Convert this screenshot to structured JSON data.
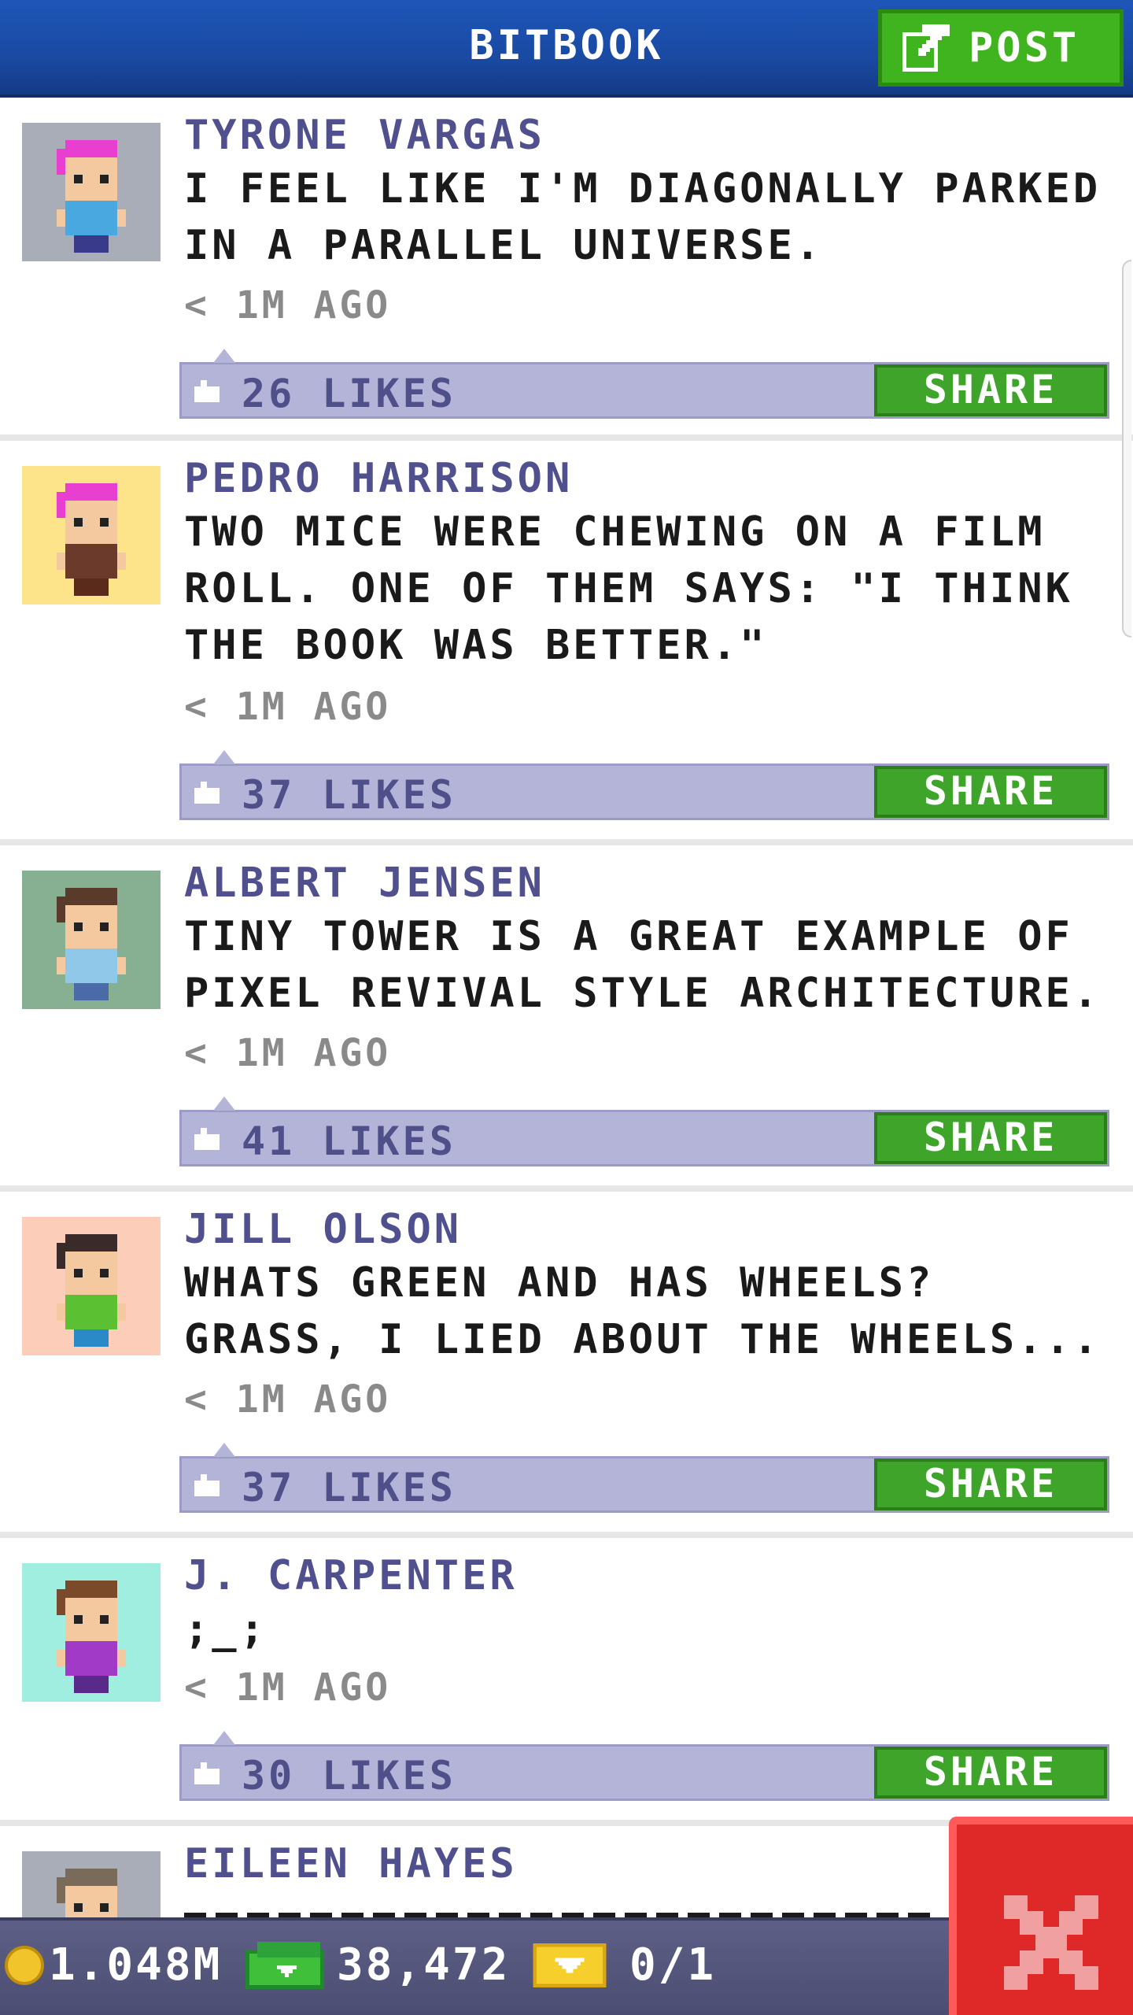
{
  "header": {
    "title": "BITBOOK",
    "post_label": "POST"
  },
  "posts": [
    {
      "author": "TYRONE VARGAS",
      "message": "I FEEL LIKE I'M DIAGONALLY PARKED IN A PARALLEL UNIVERSE.",
      "time": "< 1M AGO",
      "likes": "26 LIKES",
      "share_label": "SHARE",
      "avatar_bg": "#a9adb8",
      "hair": "#e83fd0",
      "shirt": "#4aa8e0",
      "pants": "#3a3a8a"
    },
    {
      "author": "PEDRO HARRISON",
      "message": "TWO MICE WERE CHEWING ON A FILM ROLL. ONE OF THEM SAYS: \"I THINK THE BOOK WAS BETTER.\"",
      "time": "< 1M AGO",
      "likes": "37 LIKES",
      "share_label": "SHARE",
      "avatar_bg": "#fde48a",
      "hair": "#e83fd0",
      "shirt": "#6b3a2a",
      "pants": "#5a2a1a"
    },
    {
      "author": "ALBERT JENSEN",
      "message": "TINY TOWER IS A GREAT EXAMPLE OF PIXEL REVIVAL STYLE ARCHITECTURE.",
      "time": "< 1M AGO",
      "likes": "41 LIKES",
      "share_label": "SHARE",
      "avatar_bg": "#86b091",
      "hair": "#5a3a2a",
      "shirt": "#8fc8e8",
      "pants": "#4a6aa8"
    },
    {
      "author": "JILL OLSON",
      "message": "WHATS GREEN AND HAS WHEELS? GRASS, I LIED ABOUT THE WHEELS...",
      "time": "< 1M AGO",
      "likes": "37 LIKES",
      "share_label": "SHARE",
      "avatar_bg": "#fccdb8",
      "hair": "#3a2a2a",
      "shirt": "#5cc033",
      "pants": "#2a8ac8"
    },
    {
      "author": "J. CARPENTER",
      "message": ";_;",
      "time": "< 1M AGO",
      "likes": "30 LIKES",
      "share_label": "SHARE",
      "avatar_bg": "#9feee0",
      "hair": "#7a4a2a",
      "shirt": "#a23ac8",
      "pants": "#5a2a8a"
    },
    {
      "author": "EILEEN HAYES",
      "message": "",
      "time": "",
      "likes": "",
      "share_label": "",
      "avatar_bg": "#a9adb8",
      "hair": "#7a6a5a",
      "shirt": "#8a8a8a",
      "pants": "#5a5a5a"
    }
  ],
  "status": {
    "coins": "1.048M",
    "bux": "38,472",
    "tickets": "0/1"
  },
  "colors": {
    "header_bg": "#1a4aa3",
    "post_green": "#3fb41f",
    "like_bar": "#b4b4d8",
    "author_text": "#50508e",
    "close_red": "#df2929"
  }
}
